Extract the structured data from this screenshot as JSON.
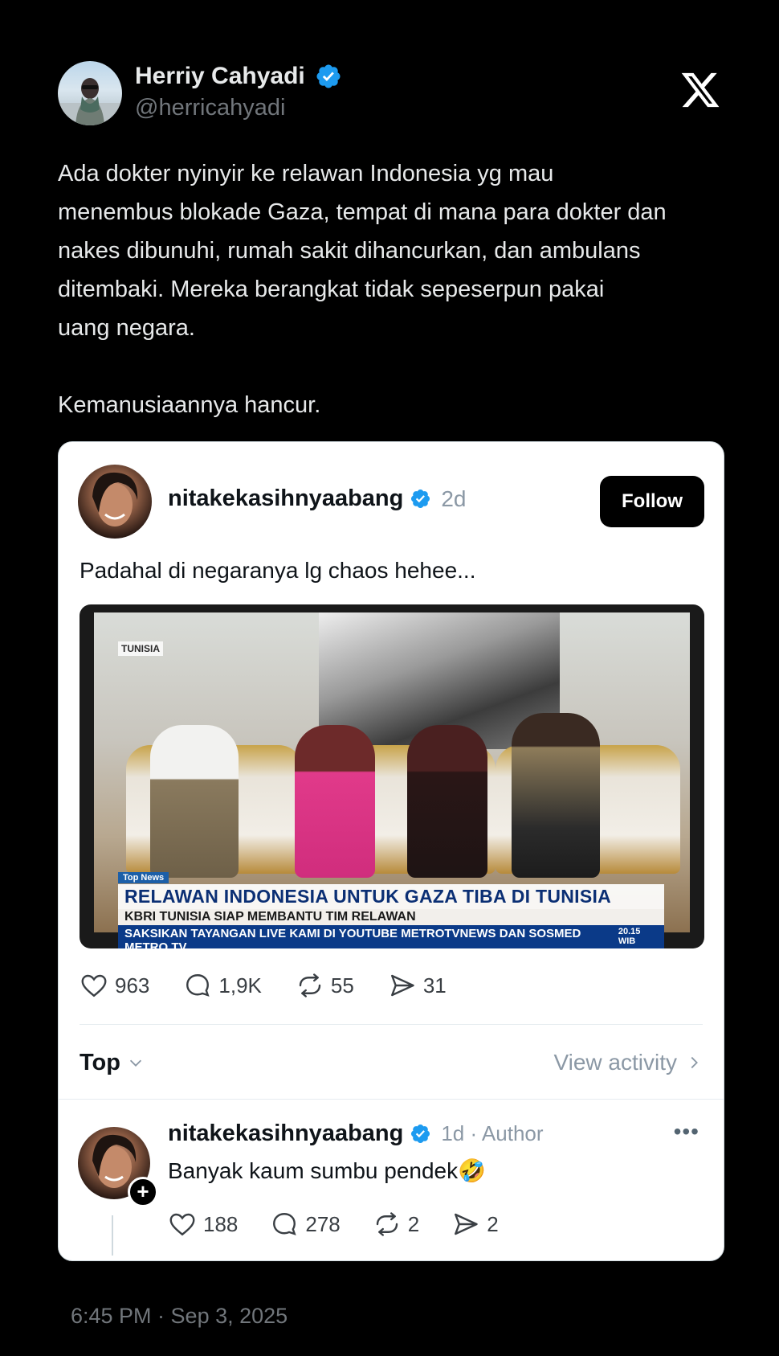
{
  "author": {
    "display_name": "Herriy Cahyadi",
    "handle": "@herricahyadi",
    "verified_icon": "verified-badge-icon"
  },
  "brand_icon": "x-logo-icon",
  "tweet": {
    "text": "Ada dokter nyinyir ke relawan Indonesia yg mau\nmenembus blokade Gaza, tempat di mana para dokter dan\nnakes dibunuhi, rumah sakit dihancurkan, dan ambulans\nditembaki. Mereka berangkat tidak sepeserpun pakai\nuang negara.\n\nKemanusiaannya hancur.",
    "timestamp": "6:45 PM · Sep 3, 2025"
  },
  "quoted_post": {
    "username": "nitakekasihnyaabang",
    "time": "2d",
    "follow_label": "Follow",
    "text": "Padahal di negaranya lg chaos hehee...",
    "media": {
      "location_tag": "TUNISIA",
      "program_tag": "Top News",
      "headline": "RELAWAN INDONESIA UNTUK GAZA TIBA DI TUNISIA",
      "subheadline": "KBRI TUNISIA SIAP MEMBANTU TIM RELAWAN",
      "ticker": "SAKSIKAN TAYANGAN LIVE KAMI DI YOUTUBE METROTVNEWS DAN SOSMED METRO TV",
      "clock": "20.15 WIB"
    },
    "stats": {
      "likes": "963",
      "replies": "1,9K",
      "reposts": "55",
      "shares": "31"
    },
    "sort_label": "Top",
    "view_activity_label": "View activity"
  },
  "reply": {
    "username": "nitakekasihnyaabang",
    "meta": "1d · Author",
    "text": "Banyak kaum sumbu pendek🤣",
    "stats": {
      "likes": "188",
      "replies": "278",
      "reposts": "2",
      "shares": "2"
    }
  },
  "colors": {
    "background": "#000000",
    "card": "#ffffff",
    "verified": "#1d9bf0",
    "muted": "#71767b"
  }
}
